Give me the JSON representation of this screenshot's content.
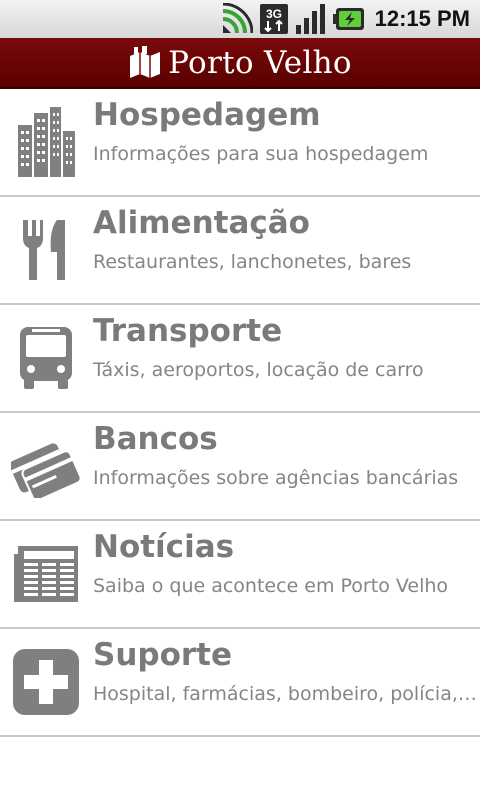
{
  "status_bar": {
    "time": "12:15 PM",
    "icons": [
      "signal-broadcast-icon",
      "3g-data-icon",
      "cell-signal-icon",
      "battery-charging-icon"
    ]
  },
  "header": {
    "title": "Porto Velho",
    "background_color": "#6a0505"
  },
  "menu": {
    "items": [
      {
        "title": "Hospedagem",
        "subtitle": "Informações para sua hospedagem",
        "icon": "buildings-icon"
      },
      {
        "title": "Alimentação",
        "subtitle": "Restaurantes, lanchonetes, bares",
        "icon": "fork-knife-icon"
      },
      {
        "title": "Transporte",
        "subtitle": "Táxis, aeroportos, locação de carro",
        "icon": "bus-icon"
      },
      {
        "title": "Bancos",
        "subtitle": "Informações sobre agências bancárias",
        "icon": "credit-cards-icon"
      },
      {
        "title": "Notícias",
        "subtitle": "Saiba o que acontece em Porto Velho",
        "icon": "newspaper-icon"
      },
      {
        "title": "Suporte",
        "subtitle": "Hospital, farmácias, bombeiro, polícia, a...",
        "icon": "medical-cross-icon"
      }
    ]
  }
}
